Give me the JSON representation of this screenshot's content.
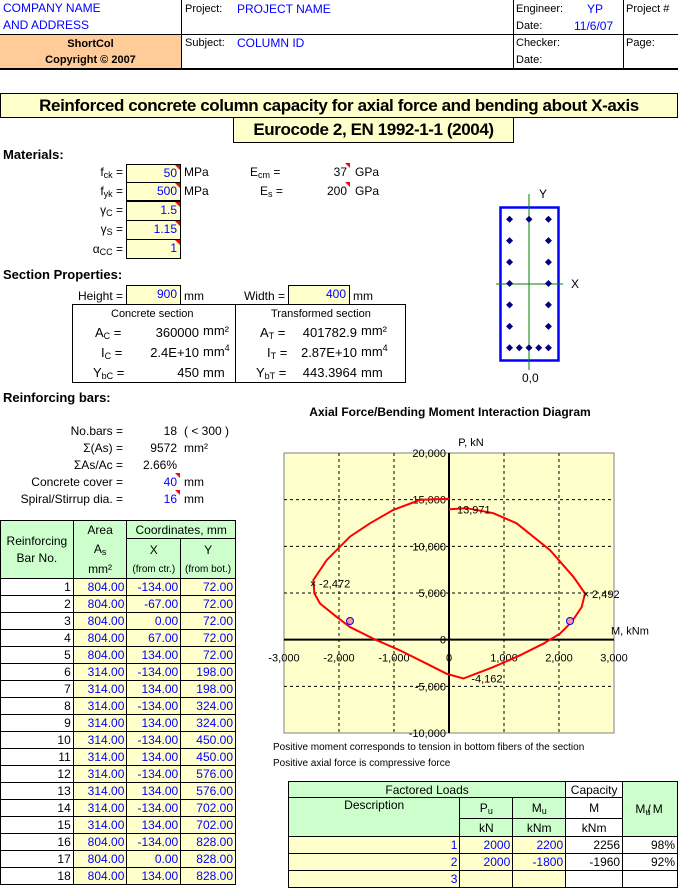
{
  "header": {
    "company_line1": "COMPANY NAME",
    "company_line2": "AND ADDRESS",
    "program_name": "ShortCol",
    "copyright": "Copyright © 2007",
    "project_label": "Project:",
    "project_value": "PROJECT NAME",
    "subject_label": "Subject:",
    "subject_value": "COLUMN ID",
    "engineer_label": "Engineer:",
    "engineer_value": "YP",
    "date_label": "Date:",
    "date_value": "11/6/07",
    "checker_label": "Checker:",
    "date2_label": "Date:",
    "project_no_label": "Project #",
    "page_label": "Page:"
  },
  "title": "Reinforced concrete column capacity for axial force and bending about X-axis",
  "subtitle": "Eurocode 2, EN 1992-1-1 (2004)",
  "materials": {
    "heading": "Materials:",
    "fck": {
      "value": "50",
      "unit": "MPa"
    },
    "fyk": {
      "value": "500",
      "unit": "MPa"
    },
    "gamma_c": {
      "value": "1.5"
    },
    "gamma_s": {
      "value": "1.15"
    },
    "alpha_cc": {
      "value": "1"
    },
    "Ecm": {
      "value": "37",
      "unit": "GPa"
    },
    "Es": {
      "value": "200",
      "unit": "GPa"
    }
  },
  "section": {
    "heading": "Section Properties:",
    "height_label": "Height =",
    "height": "900",
    "width_label": "Width =",
    "width": "400",
    "unit": "mm",
    "concrete_title": "Concrete section",
    "transformed_title": "Transformed section",
    "Ac": "360000",
    "Ic": "2.4E+10",
    "Ybc": "450",
    "At": "401782.9",
    "It": "2.87E+10",
    "Ybt": "443.3964",
    "mm2": "mm²",
    "mm4": "mm",
    "mm": "mm"
  },
  "section_sketch": {
    "x_label": "X",
    "y_label": "Y",
    "origin_label": "0,0"
  },
  "rebar": {
    "heading": "Reinforcing bars:",
    "nbars_label": "No.bars =",
    "nbars": "18",
    "nbars_limit": "( < 300 )",
    "sum_as_label": "Σ(As) =",
    "sum_as": "9572",
    "sum_as_unit": "mm²",
    "ratio_label": "ΣAs/Ac =",
    "ratio": "2.66%",
    "cover_label": "Concrete cover =",
    "cover": "40",
    "cover_unit": "mm",
    "stirrup_label": "Spiral/Stirrup dia. =",
    "stirrup": "16",
    "stirrup_unit": "mm"
  },
  "bar_table": {
    "col_bar": "Reinforcing Bar No.",
    "col_area": "Area",
    "col_area_sym": "A",
    "col_area_unit": "mm²",
    "col_coords": "Coordinates, mm",
    "col_x": "X",
    "col_x_note": "(from ctr.)",
    "col_y": "Y",
    "col_y_note": "(from bot.)",
    "rows": [
      [
        "1",
        "804.00",
        "-134.00",
        "72.00"
      ],
      [
        "2",
        "804.00",
        "-67.00",
        "72.00"
      ],
      [
        "3",
        "804.00",
        "0.00",
        "72.00"
      ],
      [
        "4",
        "804.00",
        "67.00",
        "72.00"
      ],
      [
        "5",
        "804.00",
        "134.00",
        "72.00"
      ],
      [
        "6",
        "314.00",
        "-134.00",
        "198.00"
      ],
      [
        "7",
        "314.00",
        "134.00",
        "198.00"
      ],
      [
        "8",
        "314.00",
        "-134.00",
        "324.00"
      ],
      [
        "9",
        "314.00",
        "134.00",
        "324.00"
      ],
      [
        "10",
        "314.00",
        "-134.00",
        "450.00"
      ],
      [
        "11",
        "314.00",
        "134.00",
        "450.00"
      ],
      [
        "12",
        "314.00",
        "-134.00",
        "576.00"
      ],
      [
        "13",
        "314.00",
        "134.00",
        "576.00"
      ],
      [
        "14",
        "314.00",
        "-134.00",
        "702.00"
      ],
      [
        "15",
        "314.00",
        "134.00",
        "702.00"
      ],
      [
        "16",
        "804.00",
        "-134.00",
        "828.00"
      ],
      [
        "17",
        "804.00",
        "0.00",
        "828.00"
      ],
      [
        "18",
        "804.00",
        "134.00",
        "828.00"
      ]
    ]
  },
  "chart_data": {
    "type": "line",
    "title": "Axial Force/Bending Moment Interaction Diagram",
    "xlabel": "M, kNm",
    "ylabel": "P, kN",
    "xlim": [
      -3000,
      3000
    ],
    "ylim": [
      -10000,
      20000
    ],
    "xticks": [
      "-3,000",
      "-2,000",
      "-1,000",
      "0",
      "1,000",
      "2,000",
      "3,000"
    ],
    "yticks": [
      "20,000",
      "15,000",
      "10,000",
      "5,000",
      "0",
      "-5,000",
      "-10,000"
    ],
    "grid": true,
    "background": "#ffffcc",
    "curve_color": "#ff0000",
    "curve": [
      [
        0,
        15100
      ],
      [
        -527,
        14980
      ],
      [
        -1012,
        13900
      ],
      [
        -1436,
        12470
      ],
      [
        -1800,
        11040
      ],
      [
        -1982,
        9960
      ],
      [
        -2224,
        8530
      ],
      [
        -2467,
        6380
      ],
      [
        -2448,
        4950
      ],
      [
        -2345,
        3870
      ],
      [
        -2042,
        2440
      ],
      [
        -1800,
        1360
      ],
      [
        -1376,
        100
      ],
      [
        -891,
        -1150
      ],
      [
        -406,
        -2580
      ],
      [
        -42,
        -3660
      ],
      [
        261,
        -4162
      ],
      [
        806,
        -2940
      ],
      [
        1291,
        -1680
      ],
      [
        1715,
        -430
      ],
      [
        2018,
        650
      ],
      [
        2230,
        1900
      ],
      [
        2412,
        3500
      ],
      [
        2473,
        4950
      ],
      [
        2261,
        6740
      ],
      [
        1836,
        9600
      ],
      [
        1230,
        12470
      ],
      [
        806,
        13550
      ],
      [
        321,
        14090
      ],
      [
        0,
        13971
      ]
    ],
    "annotations": [
      {
        "text": "13,971",
        "x": 0,
        "y": 13971
      },
      {
        "text": "-2,472",
        "x": -2472,
        "y": 6000,
        "marker": "x"
      },
      {
        "text": "2,492",
        "x": 2492,
        "y": 4900,
        "marker": "x"
      },
      {
        "text": "-4,162",
        "x": 261,
        "y": -4162
      }
    ],
    "load_points": [
      [
        2200,
        2000
      ],
      [
        -1800,
        2000
      ]
    ],
    "notes": [
      "Positive moment corresponds to tension in bottom fibers of the section",
      "Positive axial force is compressive force"
    ]
  },
  "loads": {
    "factored_loads": "Factored Loads",
    "capacity": "Capacity",
    "description": "Description",
    "pu": "P",
    "mu": "M",
    "m": "M",
    "ratio": "M/M",
    "kN": "kN",
    "kNm": "kNm",
    "rows": [
      [
        "1",
        "2000",
        "2200",
        "2256",
        "98%"
      ],
      [
        "2",
        "2000",
        "-1800",
        "-1960",
        "92%"
      ],
      [
        "3",
        "",
        "",
        "",
        ""
      ]
    ]
  }
}
